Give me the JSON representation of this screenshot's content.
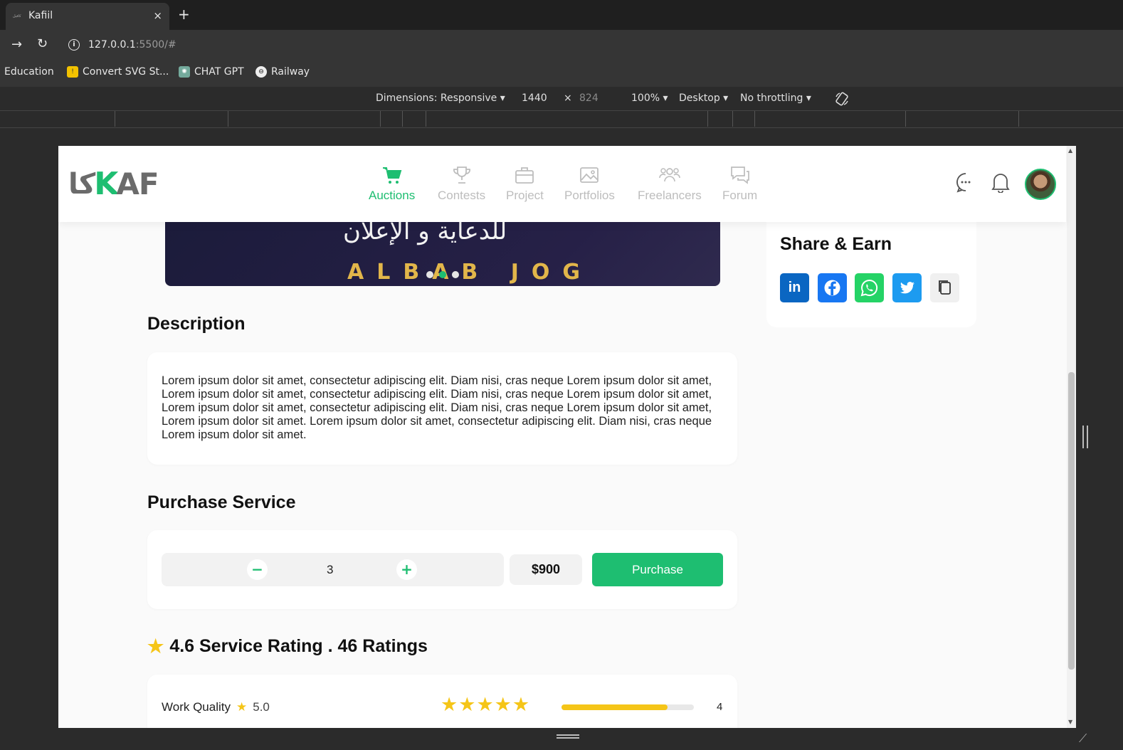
{
  "browser": {
    "tab_title": "Kafiil",
    "tab_favicon": "كافيل",
    "new_tab": "+",
    "close": "×",
    "url_host": "127.0.0.1",
    "url_rest": ":5500/#",
    "bookmarks": [
      {
        "label": "Education",
        "icon": ""
      },
      {
        "label": "Convert SVG St...",
        "icon": "!"
      },
      {
        "label": "CHAT GPT",
        "icon": "✺"
      },
      {
        "label": "Railway",
        "icon": "⊖"
      }
    ]
  },
  "devtools": {
    "dimensions": "Dimensions: Responsive ▾",
    "width": "1440",
    "times": "×",
    "height": "824",
    "zoom": "100% ▾",
    "device": "Desktop ▾",
    "throttle": "No throttling ▾"
  },
  "site": {
    "logo_ar": "كا",
    "logo_k": "K",
    "logo_en": "AF",
    "nav": [
      {
        "label": "Auctions",
        "icon": "cart-icon",
        "active": true
      },
      {
        "label": "Contests",
        "icon": "trophy-icon",
        "active": false
      },
      {
        "label": "Project",
        "icon": "briefcase-icon",
        "active": false
      },
      {
        "label": "Portfolios",
        "icon": "image-icon",
        "active": false
      },
      {
        "label": "Freelancers",
        "icon": "users-icon",
        "active": false
      },
      {
        "label": "Forum",
        "icon": "chat-icon",
        "active": false
      }
    ]
  },
  "hero": {
    "arabic_text": "للدعاية و الإعلان",
    "gold_text": "ALBAB JOG"
  },
  "description": {
    "title": "Description",
    "text": "Lorem ipsum dolor sit amet, consectetur adipiscing elit. Diam nisi, cras neque Lorem ipsum dolor sit amet, Lorem ipsum dolor sit amet, consectetur adipiscing elit. Diam nisi, cras neque Lorem ipsum dolor sit amet, Lorem ipsum dolor sit amet, consectetur adipiscing elit. Diam nisi, cras neque Lorem ipsum dolor sit amet, Lorem ipsum dolor sit amet. Lorem ipsum dolor sit amet, consectetur adipiscing elit. Diam nisi, cras neque Lorem ipsum dolor sit amet."
  },
  "purchase": {
    "title": "Purchase Service",
    "minus": "−",
    "plus": "+",
    "quantity": "3",
    "price": "$900",
    "button": "Purchase"
  },
  "rating": {
    "title": "4.6 Service Rating . 46 Ratings",
    "rows": [
      {
        "label": "Work Quality",
        "score": "5.0",
        "stars": 5,
        "fill": 0.8,
        "count": "4"
      }
    ]
  },
  "share": {
    "title": "Share & Earn",
    "buttons": [
      {
        "name": "linkedin",
        "glyph": "in",
        "color": "#0a66c2"
      },
      {
        "name": "facebook",
        "glyph": "f",
        "color": "#1877f2"
      },
      {
        "name": "whatsapp",
        "glyph": "✆",
        "color": "#25d366"
      },
      {
        "name": "twitter",
        "glyph": "🐦",
        "color": "#1d9bf0"
      },
      {
        "name": "copy",
        "glyph": "⧉",
        "color": "#f0f0f0"
      }
    ]
  },
  "colors": {
    "accent": "#1ebe71",
    "star": "#f5c518"
  }
}
